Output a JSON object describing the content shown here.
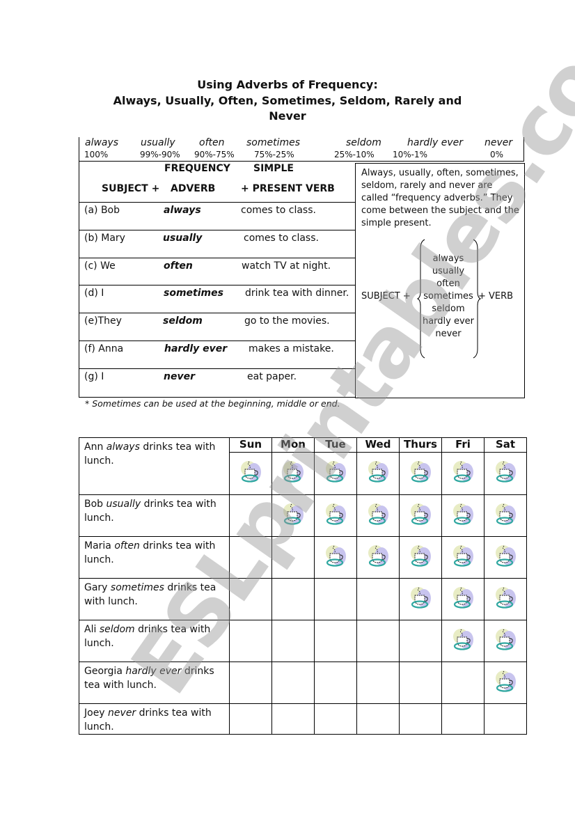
{
  "title": {
    "line1": "Using Adverbs of Frequency:",
    "line2": "Always, Usually, Often, Sometimes, Seldom, Rarely and Never"
  },
  "scale": [
    {
      "word": "always",
      "percent": "100%"
    },
    {
      "word": "usually",
      "percent": "99%-90%"
    },
    {
      "word": "often",
      "percent": "90%-75%"
    },
    {
      "word": "sometimes",
      "percent": "75%-25%"
    },
    {
      "word": "seldom",
      "percent": "25%-10%"
    },
    {
      "word": "hardly ever",
      "percent": "10%-1%"
    },
    {
      "word": "never",
      "percent": "0%"
    }
  ],
  "grammar_table": {
    "header_top": {
      "frequency": "FREQUENCY",
      "simple": "SIMPLE"
    },
    "header_bottom": {
      "subject": "SUBJECT +",
      "adverb": "ADVERB",
      "verb": "+  PRESENT VERB"
    },
    "rows": [
      {
        "subject": "(a) Bob",
        "adverb": "always",
        "verb": "comes to class."
      },
      {
        "subject": "(b) Mary",
        "adverb": "usually",
        "verb": "comes to class."
      },
      {
        "subject": "(c) We",
        "adverb": "often",
        "verb": "watch TV at night."
      },
      {
        "subject": "(d) I",
        "adverb": "sometimes",
        "verb": "drink tea with dinner."
      },
      {
        "subject": "(e)They",
        "adverb": "seldom",
        "verb": "go to the movies."
      },
      {
        "subject": "(f) Anna",
        "adverb": "hardly ever",
        "verb": "makes a mistake."
      },
      {
        "subject": "(g) I",
        "adverb": "never",
        "verb": "eat paper."
      }
    ],
    "footnote": "* Sometimes can be used at the beginning, middle or end."
  },
  "explanation": {
    "text": "Always, usually, often, sometimes, seldom, rarely and never are called “frequency adverbs.” They come between the subject and the simple present.",
    "subject_label": "SUBJECT +",
    "verb_label": "+ VERB",
    "adverbs": [
      "always",
      "usually",
      "often",
      "sometimes",
      "seldom",
      "hardly ever",
      "never"
    ]
  },
  "week_table": {
    "days": [
      "Sun",
      "Mon",
      "Tue",
      "Wed",
      "Thurs",
      "Fri",
      "Sat"
    ],
    "rows": [
      {
        "name": "Ann",
        "adverb": "always",
        "rest_line1": "drinks tea with",
        "rest_line2": "lunch.",
        "tea_days": [
          true,
          true,
          true,
          true,
          true,
          true,
          true
        ]
      },
      {
        "name": "Bob",
        "adverb": "usually",
        "rest_line1": "drinks tea with",
        "rest_line2": "lunch.",
        "tea_days": [
          false,
          true,
          true,
          true,
          true,
          true,
          true
        ]
      },
      {
        "name": "Maria",
        "adverb": "often",
        "rest_line1": "drinks tea with",
        "rest_line2": "lunch.",
        "tea_days": [
          false,
          false,
          true,
          true,
          true,
          true,
          true
        ]
      },
      {
        "name": "Gary",
        "adverb": "sometimes",
        "rest_line1": "drinks tea",
        "rest_line2": "with lunch.",
        "tea_days": [
          false,
          false,
          false,
          false,
          true,
          true,
          true
        ]
      },
      {
        "name": "Ali",
        "adverb": "seldom",
        "rest_line1": "drinks tea with",
        "rest_line2": "lunch.",
        "tea_days": [
          false,
          false,
          false,
          false,
          false,
          true,
          true
        ]
      },
      {
        "name": "Georgia",
        "adverb": "hardly ever",
        "rest_line1": "drinks",
        "rest_line2": "tea with lunch.",
        "tea_days": [
          false,
          false,
          false,
          false,
          false,
          false,
          true
        ]
      },
      {
        "name": "Joey",
        "adverb": "never",
        "rest_line1": "drinks tea with",
        "rest_line2": "lunch.",
        "tea_days": [
          false,
          false,
          false,
          false,
          false,
          false,
          false
        ]
      }
    ],
    "icon": "teacup-icon"
  },
  "watermark": "ESLprintables.com",
  "colors": {
    "text": "#111111",
    "border": "#000000",
    "watermark": "#969696",
    "cup_saucer": "#2fa7a0",
    "cup_bg_yellow": "#e8ecc4",
    "cup_bg_purple": "#c8c4ee"
  }
}
